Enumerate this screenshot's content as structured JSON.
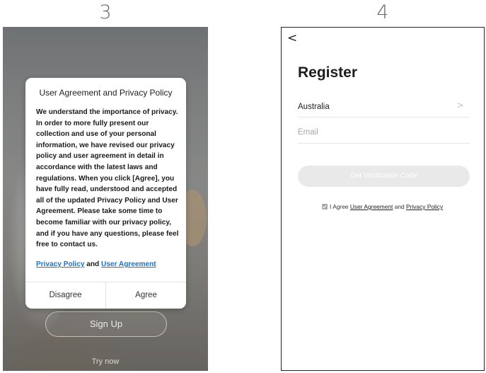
{
  "steps": {
    "left": "3",
    "right": "4"
  },
  "panel3": {
    "dialog": {
      "title": "User Agreement and Privacy Policy",
      "body": "We understand the importance of privacy. In order to more fully present our collection and use of your personal information, we have revised our privacy policy and user agreement in detail in accordance with the latest laws and regulations. When you click [Agree], you have fully read, understood and accepted all of the updated Privacy Policy and User Agreement. Please take some time to become familiar with our privacy policy, and if you have any questions, please feel free to contact us.",
      "privacy_link": "Privacy Policy",
      "and_text": " and ",
      "agreement_link": "User Agreement",
      "disagree_label": "Disagree",
      "agree_label": "Agree"
    },
    "signup_label": "Sign Up",
    "try_now_label": "Try now"
  },
  "panel4": {
    "back_icon": "<",
    "title": "Register",
    "country": "Australia",
    "chevron_icon": ">",
    "email_placeholder": "Email",
    "email_value": "",
    "verify_label": "Get Verification Code",
    "agree_prefix": "I Agree ",
    "agree_user_agreement": "User Agreement",
    "agree_and": " and ",
    "agree_privacy_policy": "Privacy Policy",
    "agree_checked": true
  },
  "colors": {
    "link_blue": "#1a73c9",
    "button_disabled_gray": "#e9e9e9",
    "checkbox_gray": "#a9a9a9"
  },
  "icons": {
    "back": "back-arrow-icon",
    "chevron": "chevron-right-icon",
    "checkbox": "checkbox-checked-icon"
  }
}
